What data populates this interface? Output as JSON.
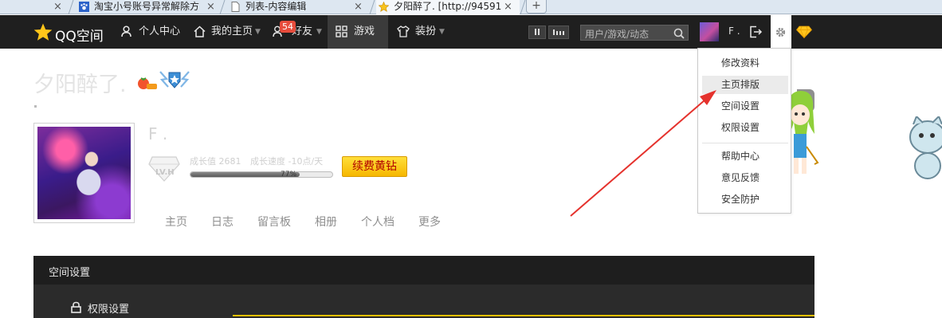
{
  "browser": {
    "tabs": [
      {
        "title": "淘宝小号账号异常解除方",
        "close": "×"
      },
      {
        "title": "列表-内容编辑",
        "close": "×"
      },
      {
        "title": "夕阳醉了. [http://94591",
        "close": "×"
      }
    ],
    "first_close": "×",
    "new_tab": "+"
  },
  "topbar": {
    "logo_text": "QQ空间",
    "nav": [
      {
        "label": "个人中心"
      },
      {
        "label": "我的主页"
      },
      {
        "label": "好友"
      },
      {
        "label": "游戏"
      },
      {
        "label": "装扮"
      }
    ],
    "friends_badge": "54",
    "search_placeholder": "用户/游戏/动态",
    "username": "F ."
  },
  "profile": {
    "space_title": "夕阳醉了.",
    "name": "F .",
    "level_badge": "LV.H",
    "growth_value_label": "成长值 2681",
    "growth_speed_label": "成长速度 -10点/天",
    "progress_text": "77%",
    "progress_fraction": 0.77,
    "renew_button": "续费黄钻",
    "subnav": [
      "主页",
      "日志",
      "留言板",
      "相册",
      "个人档",
      "更多"
    ]
  },
  "settings_panel": {
    "title": "空间设置",
    "permission": "权限设置"
  },
  "dropdown": {
    "items": [
      "修改资料",
      "主页排版",
      "空间设置",
      "权限设置",
      "帮助中心",
      "意见反馈",
      "安全防护"
    ],
    "highlighted": "主页排版"
  },
  "colors": {
    "topbar": "#1f1f1f",
    "accent_gold": "#f6b700",
    "badge_red": "#e74c3c",
    "annotation_arrow": "#e5322d"
  },
  "icons": [
    "star-logo-icon",
    "person-icon",
    "home-icon",
    "friends-icon",
    "grid-icon",
    "shirt-icon",
    "search-icon",
    "logout-icon",
    "gear-icon",
    "diamond-icon",
    "lock-icon",
    "pause-icon",
    "bars-icon"
  ]
}
